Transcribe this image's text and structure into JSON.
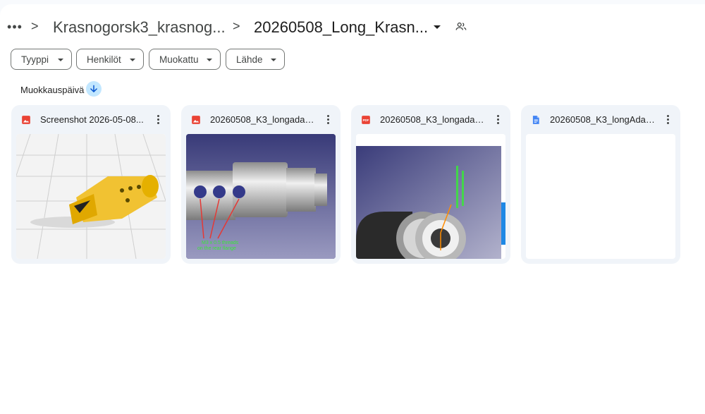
{
  "breadcrumb": {
    "more_glyph": "•••",
    "separator": ">",
    "parent_folder": "Krasnogorsk3_krasnog...",
    "current_folder": "20260508_Long_Krasn..."
  },
  "filters": [
    {
      "label": "Tyyppi"
    },
    {
      "label": "Henkilöt"
    },
    {
      "label": "Muokattu"
    },
    {
      "label": "Lähde"
    }
  ],
  "sort": {
    "label": "Muokkauspäivä",
    "direction": "descending"
  },
  "files": [
    {
      "name": "Screenshot 2026-05-08...",
      "type": "image",
      "icon": "image-icon",
      "icon_color": "#ea4335"
    },
    {
      "name": "20260508_K3_longadap...",
      "type": "image",
      "icon": "image-icon",
      "icon_color": "#ea4335"
    },
    {
      "name": "20260508_K3_longadap...",
      "type": "pdf",
      "icon": "pdf-icon",
      "icon_color": "#ea4335",
      "icon_text": "PDF"
    },
    {
      "name": "20260508_K3_longAdap...",
      "type": "document",
      "icon": "docs-icon",
      "icon_color": "#4285f4"
    }
  ],
  "thumbnails": {
    "render_label_line1": "M3 x 0.5 threads",
    "render_label_line2": "on the rear flange"
  },
  "colors": {
    "accent": "#c2e7ff",
    "card_bg": "#f0f4f9",
    "chip_border": "#747775"
  }
}
